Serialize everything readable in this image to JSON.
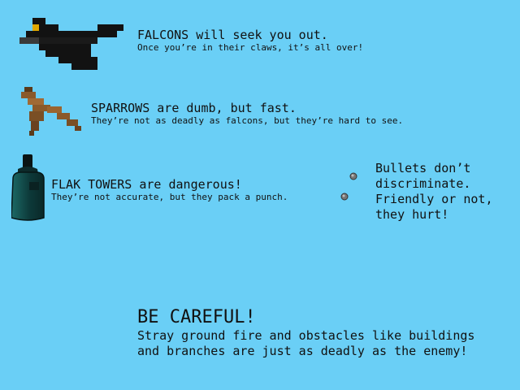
{
  "falcons": {
    "icon": "falcon-sprite",
    "title": "FALCONS will seek you out.",
    "description": "Once you’re in their claws, it’s all over!"
  },
  "sparrows": {
    "icon": "sparrow-sprite",
    "title": "SPARROWS are dumb, but fast.",
    "description": "They’re not as deadly as falcons, but they’re hard to see."
  },
  "flak_towers": {
    "icon": "flak-tower-sprite",
    "title": "FLAK TOWERS are dangerous!",
    "description": "They’re not accurate, but they pack a punch."
  },
  "bullets": {
    "icon": "bullet-sprite",
    "text": "Bullets don’t\ndiscriminate.\nFriendly or not,\nthey hurt!"
  },
  "warning": {
    "title": "BE CAREFUL!",
    "text": "Stray ground fire and obstacles like buildings\nand branches are just as deadly as the enemy!"
  },
  "colors": {
    "background": "#6acff6",
    "falcon_body": "#121212",
    "falcon_eye": "#e0a800",
    "sparrow": "#8a5a2b",
    "flak_tower": "#0d3a3a",
    "bullet": "#777777"
  }
}
